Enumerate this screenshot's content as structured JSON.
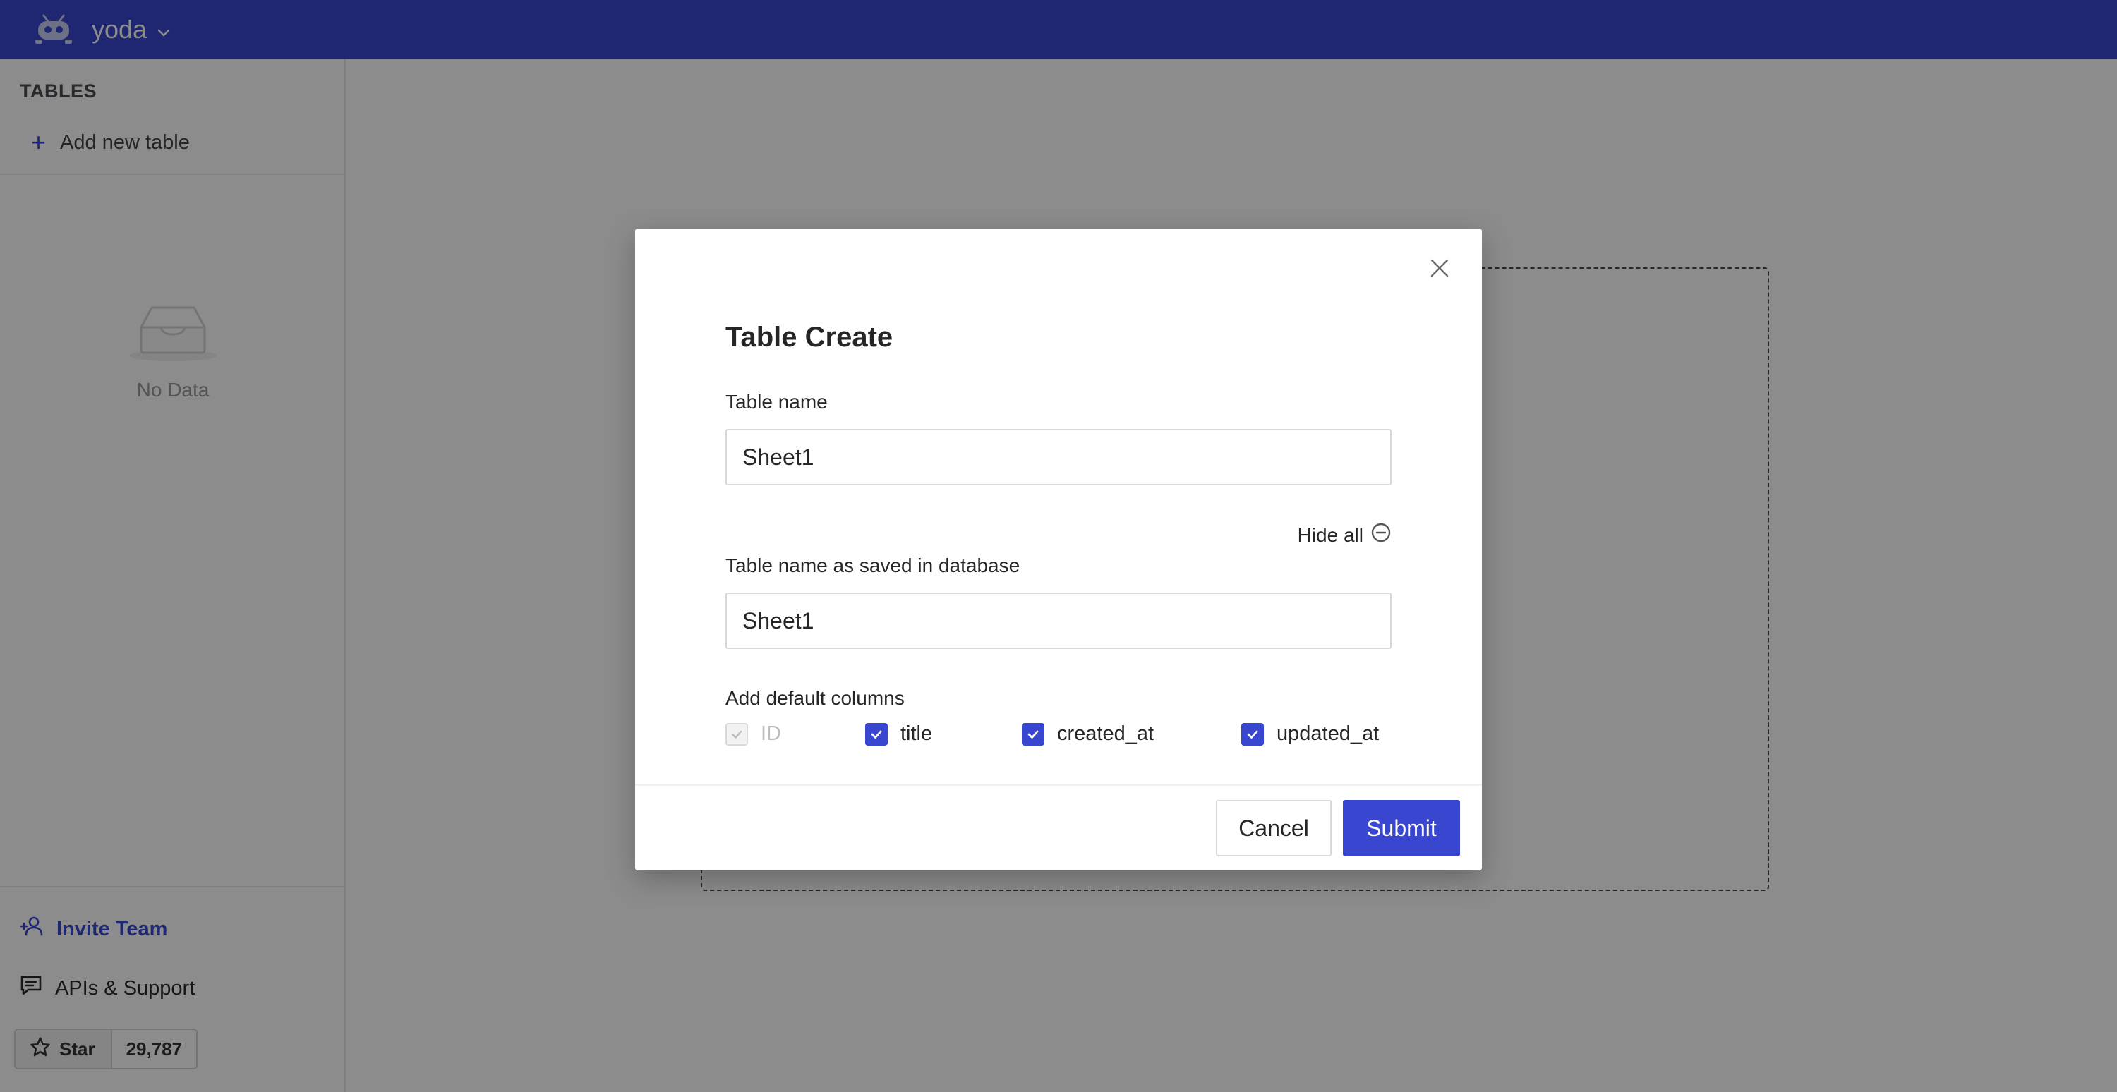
{
  "topbar": {
    "project_name": "yoda",
    "logo_icon": "robot-logo-icon",
    "dropdown_icon": "chevron-down-icon",
    "background": "#3946cf"
  },
  "sidebar": {
    "section_title": "TABLES",
    "add_table_label": "Add new table",
    "empty_text": "No Data",
    "invite_label": "Invite Team",
    "apis_label": "APIs & Support",
    "star_label": "Star",
    "star_count": "29,787"
  },
  "modal": {
    "title": "Table Create",
    "table_name_label": "Table name",
    "table_name_value": "Sheet1",
    "hide_all_label": "Hide all",
    "db_name_label": "Table name as saved in database",
    "db_name_value": "Sheet1",
    "default_columns_label": "Add default columns",
    "columns": [
      {
        "label": "ID",
        "checked": true,
        "disabled": true
      },
      {
        "label": "title",
        "checked": true,
        "disabled": false
      },
      {
        "label": "created_at",
        "checked": true,
        "disabled": false
      },
      {
        "label": "updated_at",
        "checked": true,
        "disabled": false
      }
    ],
    "cancel_label": "Cancel",
    "submit_label": "Submit"
  },
  "colors": {
    "accent": "#3946cf",
    "overlay": "rgba(0,0,0,0.45)"
  }
}
